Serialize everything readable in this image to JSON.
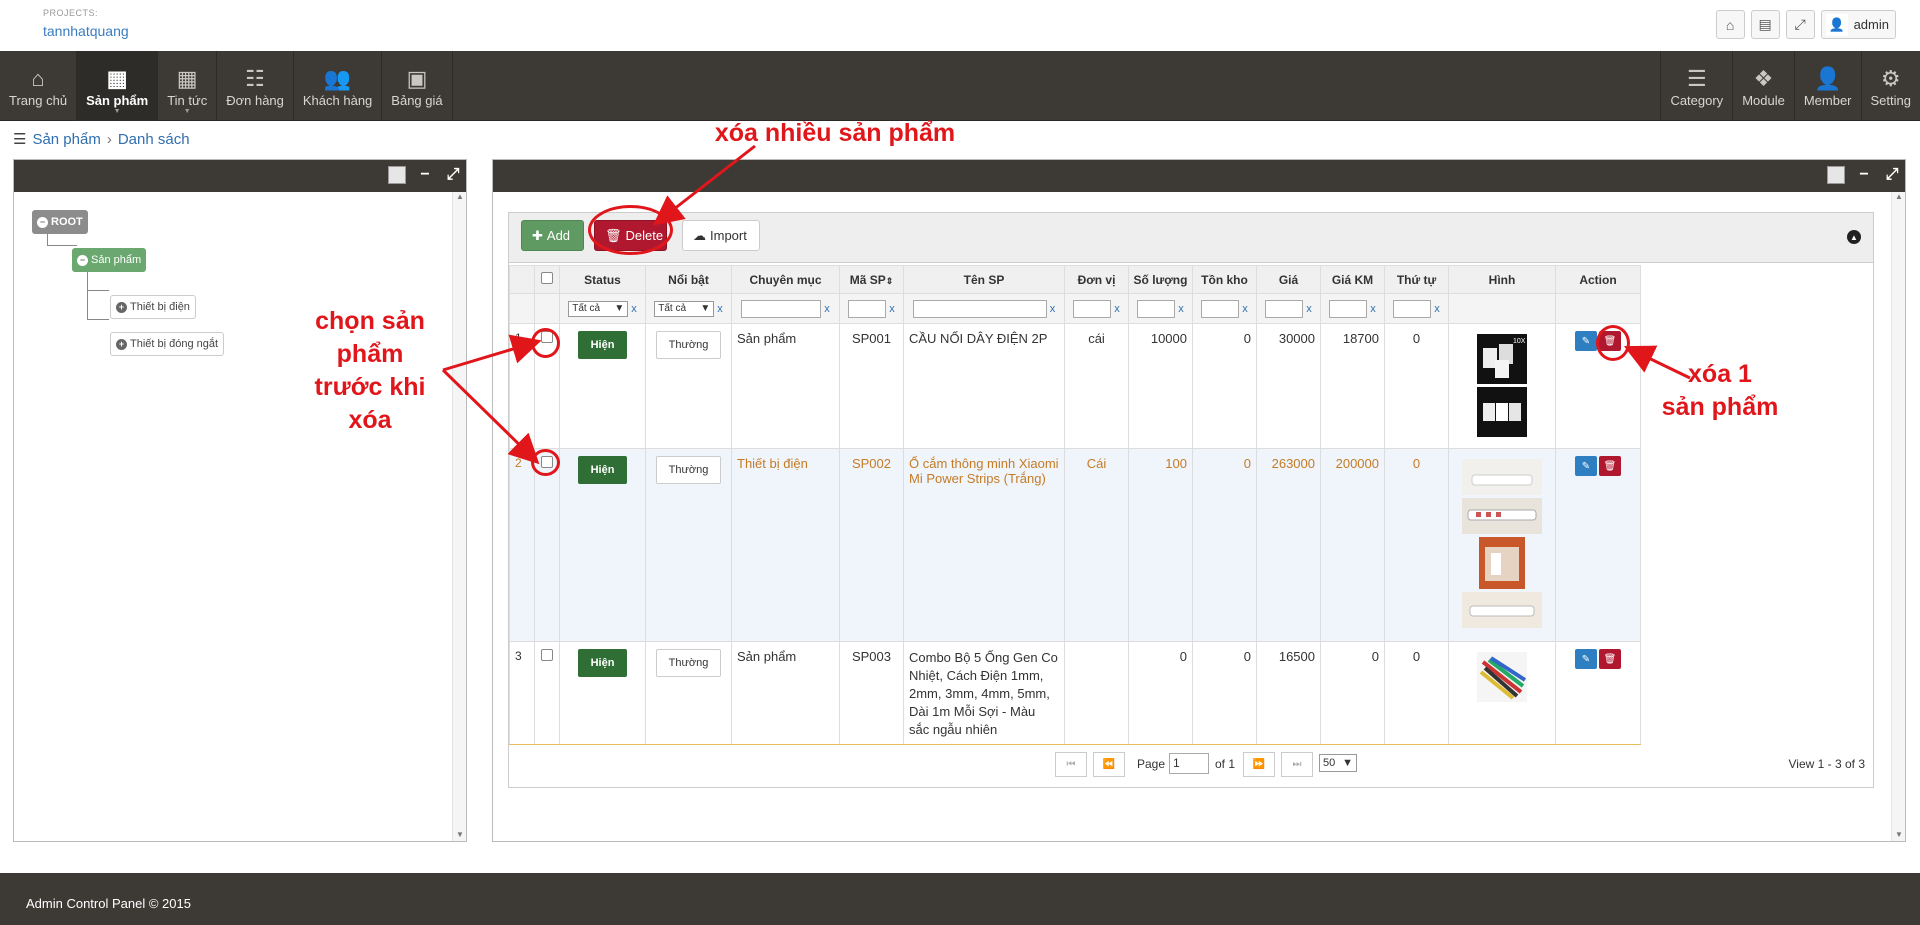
{
  "project": {
    "caption": "PROJECTS:",
    "name": "tannhatquang"
  },
  "user": {
    "name": "admin"
  },
  "nav": {
    "left": [
      {
        "label": "Trang chủ",
        "icon": "home-icon"
      },
      {
        "label": "Sản phẩm",
        "icon": "grid-icon",
        "active": true
      },
      {
        "label": "Tin tức",
        "icon": "news-icon"
      },
      {
        "label": "Đơn hàng",
        "icon": "orders-icon"
      },
      {
        "label": "Khách hàng",
        "icon": "users-icon"
      },
      {
        "label": "Bảng giá",
        "icon": "qr-icon"
      }
    ],
    "right": [
      {
        "label": "Category",
        "icon": "list-icon"
      },
      {
        "label": "Module",
        "icon": "cubes-icon"
      },
      {
        "label": "Member",
        "icon": "user-icon"
      },
      {
        "label": "Setting",
        "icon": "gears-icon"
      }
    ]
  },
  "breadcrumb": {
    "first": "Sản phẩm",
    "second": "Danh sách"
  },
  "tree": {
    "root": "ROOT",
    "node": "Sản phẩm",
    "children": [
      "Thiết bị điện",
      "Thiết bị đóng ngắt"
    ]
  },
  "toolbar": {
    "add": "Add",
    "delete": "Delete",
    "import": "Import"
  },
  "columns": [
    "Status",
    "Nổi bật",
    "Chuyên mục",
    "Mã SP",
    "Tên SP",
    "Đơn vị",
    "Số lượng",
    "Tồn kho",
    "Giá",
    "Giá KM",
    "Thứ tự",
    "Hình",
    "Action"
  ],
  "filters": {
    "status": "Tất cả",
    "featured": "Tất cả",
    "clear": "x"
  },
  "rows": [
    {
      "num": "1",
      "status": "Hiện",
      "featured": "Thường",
      "category": "Sản phẩm",
      "code": "SP001",
      "name": "CẦU NỐI DÂY ĐIỆN 2P",
      "unit": "cái",
      "qty": "10000",
      "stock": "0",
      "price": "30000",
      "promo": "18700",
      "order": "0"
    },
    {
      "num": "2",
      "status": "Hiện",
      "featured": "Thường",
      "category": "Thiết bị điện",
      "code": "SP002",
      "name": "Ổ cắm thông minh Xiaomi Mi Power Strips (Trắng)",
      "unit": "Cái",
      "qty": "100",
      "stock": "0",
      "price": "263000",
      "promo": "200000",
      "order": "0"
    },
    {
      "num": "3",
      "status": "Hiện",
      "featured": "Thường",
      "category": "Sản phẩm",
      "code": "SP003",
      "name": "Combo Bộ 5 Ống Gen Co Nhiệt, Cách Điện 1mm, 2mm, 3mm, 4mm, 5mm, Dài 1m Mỗi Sợi - Màu sắc ngẫu nhiên",
      "unit": "",
      "qty": "0",
      "stock": "0",
      "price": "16500",
      "promo": "0",
      "order": "0"
    }
  ],
  "pager": {
    "page_label": "Page",
    "page": "1",
    "of": "of 1",
    "size": "50",
    "view": "View 1 - 3 of 3"
  },
  "footer": "Admin Control Panel © 2015",
  "annotations": {
    "bulk_delete": "xóa nhiều sản phẩm",
    "select_first": [
      "chọn sản",
      "phẩm",
      "trước khi",
      "xóa"
    ],
    "delete_one": [
      "xóa 1",
      "sản phẩm"
    ]
  },
  "colors": {
    "nav": "#3d3a36",
    "add": "#5f9a62",
    "delete": "#b0182f",
    "status": "#2f6e35",
    "annotation": "#e1161b"
  }
}
